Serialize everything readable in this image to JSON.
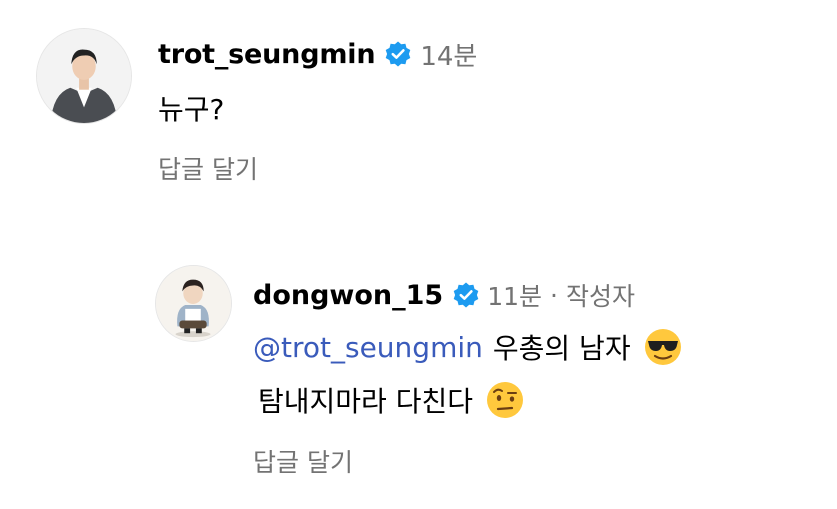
{
  "comments": [
    {
      "username": "trot_seungmin",
      "time": "14분",
      "text": "뉴구?",
      "reply_label": "답글 달기"
    },
    {
      "username": "dongwon_15",
      "time": "11분",
      "separator": "·",
      "author_badge": "작성자",
      "mention": "@trot_seungmin",
      "text_line1": "우총의 남자",
      "text_line2": "탐내지마라 다친다",
      "emoji1": "smiling-face-with-sunglasses",
      "emoji2": "face-with-raised-eyebrow",
      "reply_label": "답글 달기"
    }
  ],
  "colors": {
    "verified": "#1d9bf0",
    "mention": "#3a5bbb",
    "secondary_text": "#737373"
  }
}
